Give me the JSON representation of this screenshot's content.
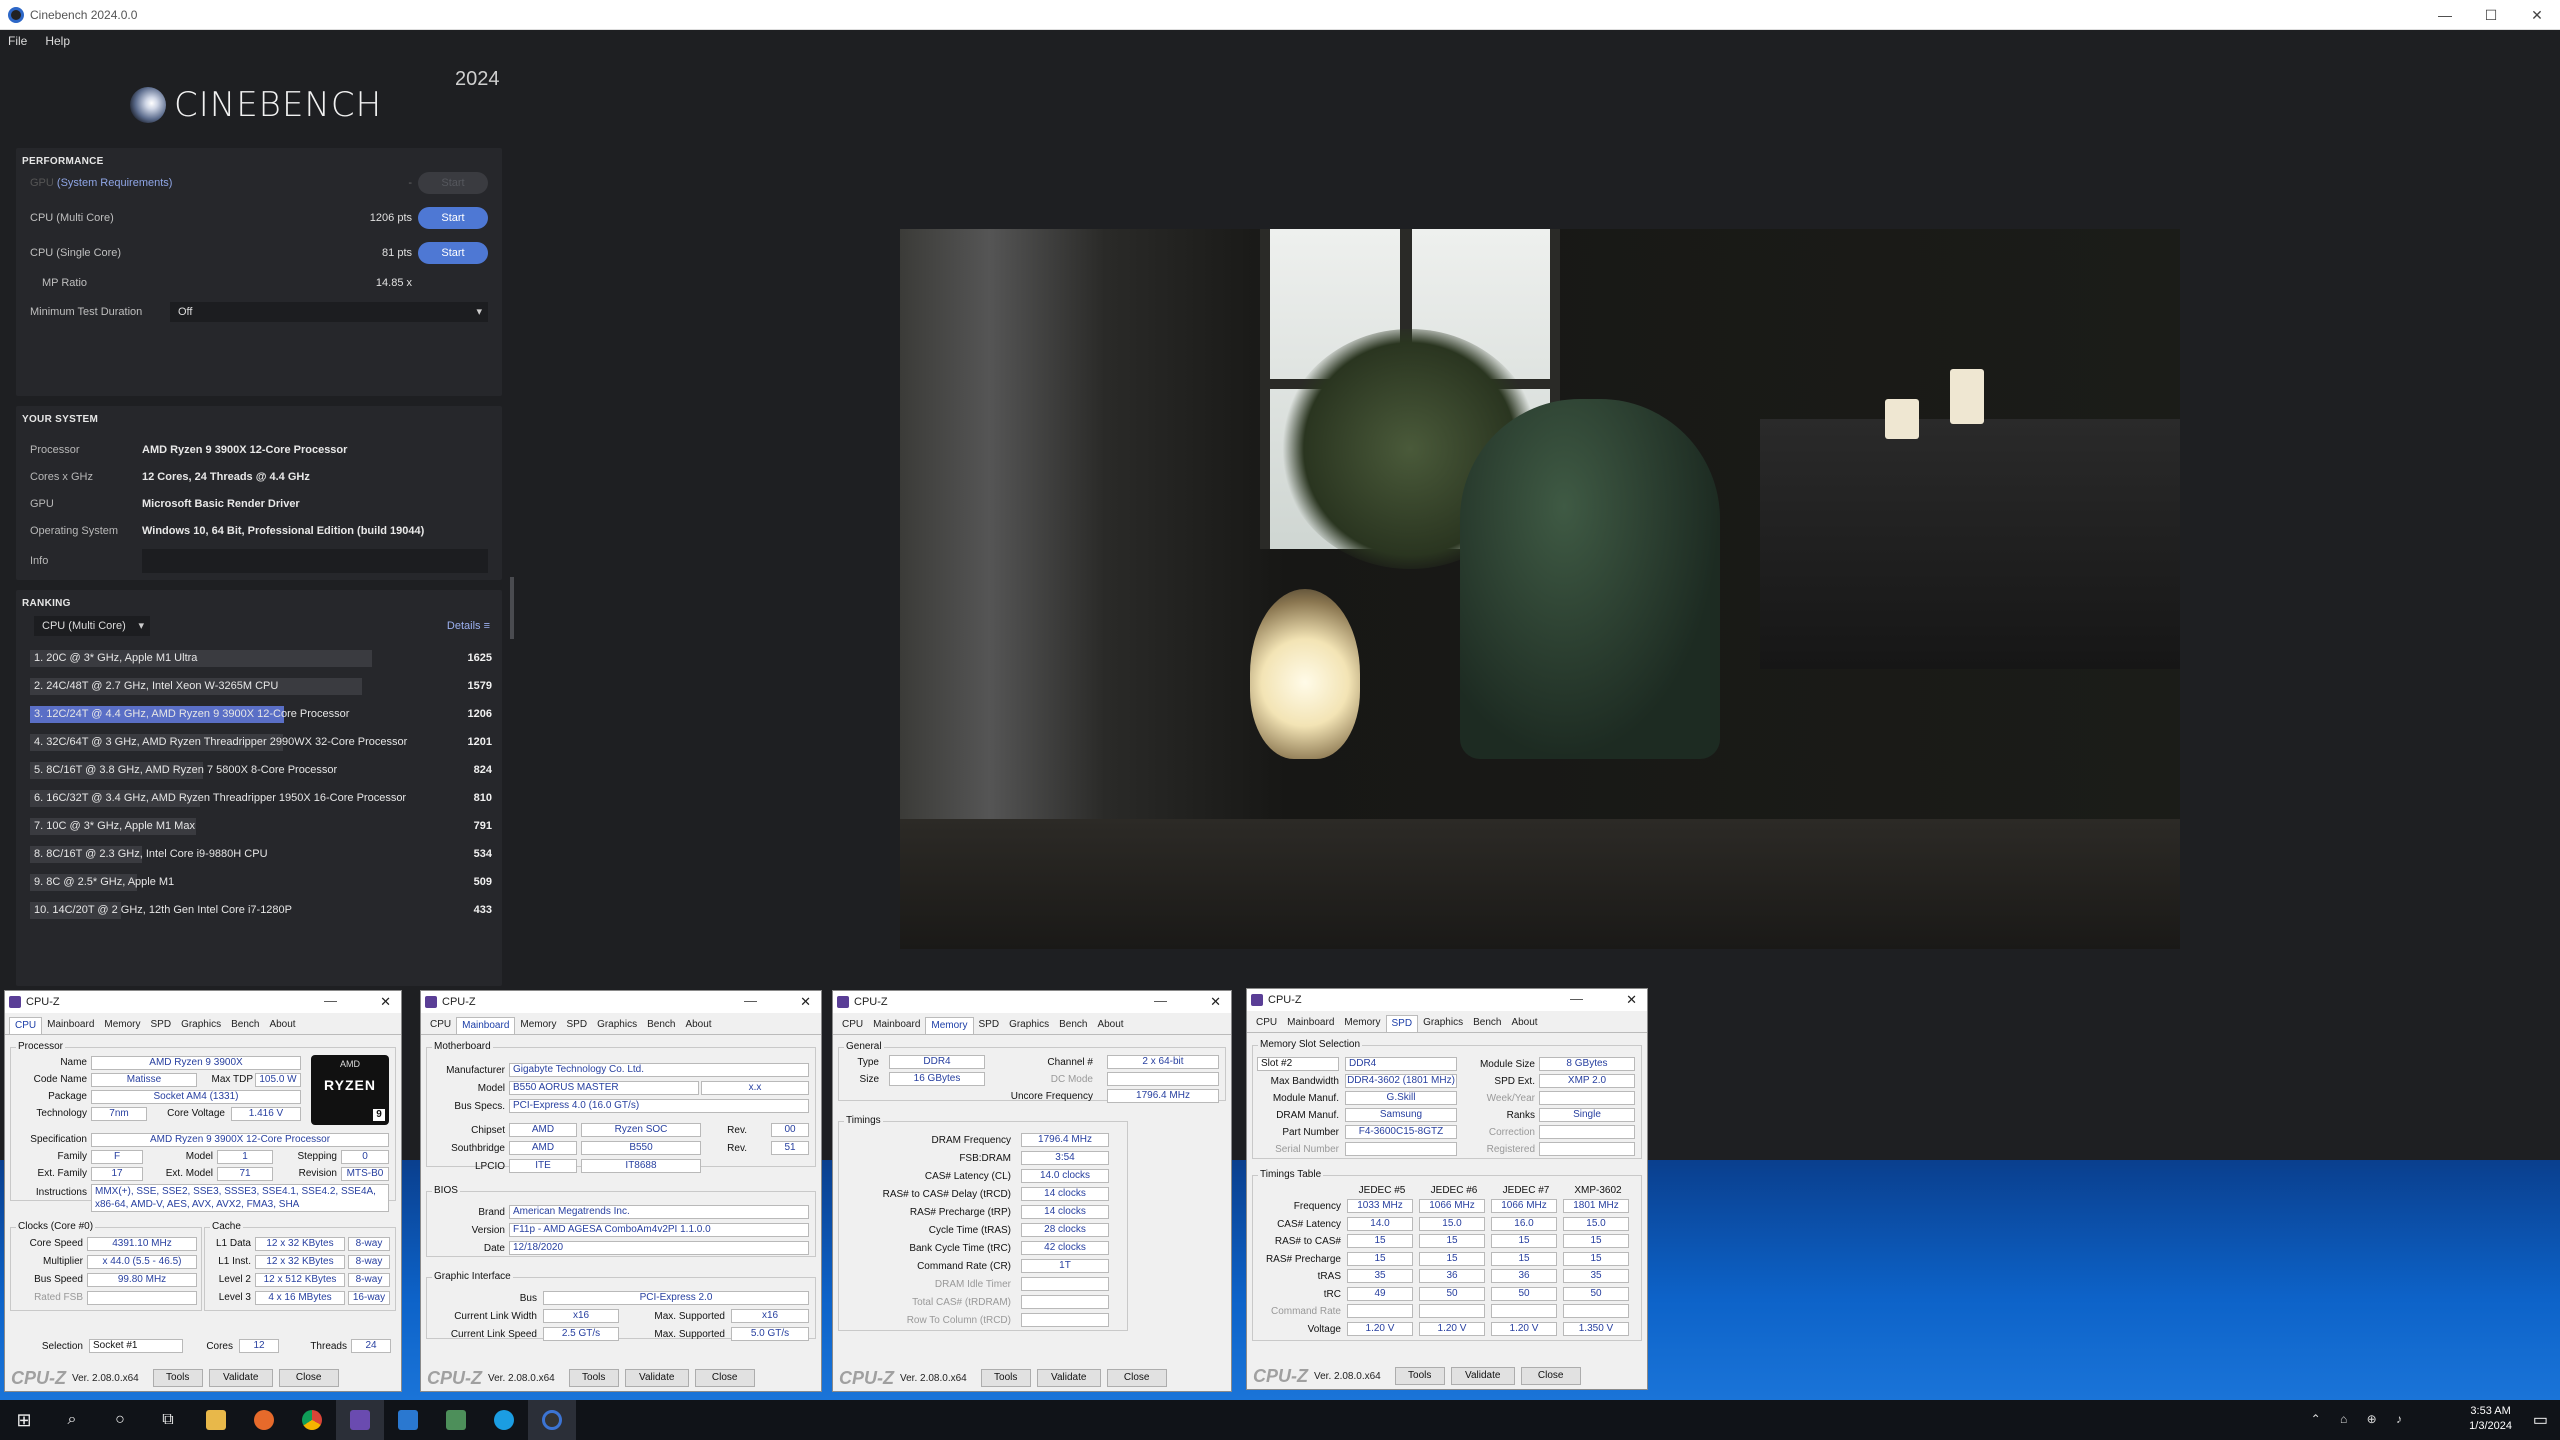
{
  "window": {
    "title": "Cinebench 2024.0.0",
    "minimize": "—",
    "maximize": "☐",
    "close": "✕"
  },
  "menu": [
    "File",
    "Help"
  ],
  "cinebench": {
    "logo": "CINEBENCH",
    "year": "2024",
    "performance": {
      "header": "PERFORMANCE",
      "gpu": {
        "label": "GPU",
        "link": "(System Requirements)",
        "value": "-",
        "button": "Start"
      },
      "multi": {
        "label": "CPU (Multi Core)",
        "value": "1206 pts",
        "button": "Start"
      },
      "single": {
        "label": "CPU (Single Core)",
        "value": "81 pts",
        "button": "Start"
      },
      "mp": {
        "label": "MP Ratio",
        "value": "14.85 x"
      },
      "duration": {
        "label": "Minimum Test Duration",
        "value": "Off"
      }
    },
    "system": {
      "header": "YOUR SYSTEM",
      "rows": [
        {
          "k": "Processor",
          "v": "AMD Ryzen 9 3900X 12-Core Processor"
        },
        {
          "k": "Cores x GHz",
          "v": "12 Cores, 24 Threads @ 4.4 GHz"
        },
        {
          "k": "GPU",
          "v": "Microsoft Basic Render Driver"
        },
        {
          "k": "Operating System",
          "v": "Windows 10, 64 Bit, Professional Edition (build 19044)"
        }
      ],
      "info_label": "Info"
    },
    "ranking": {
      "header": "RANKING",
      "filter": "CPU (Multi Core)",
      "details": "Details",
      "items": [
        {
          "label": "1. 20C @ 3* GHz, Apple M1 Ultra",
          "score": "1625",
          "frac": 1.0,
          "me": false
        },
        {
          "label": "2. 24C/48T @ 2.7 GHz, Intel Xeon W-3265M CPU",
          "score": "1579",
          "frac": 0.97,
          "me": false
        },
        {
          "label": "3. 12C/24T @ 4.4 GHz, AMD Ryzen 9 3900X 12-Core Processor",
          "score": "1206",
          "frac": 0.742,
          "me": true
        },
        {
          "label": "4. 32C/64T @ 3 GHz, AMD Ryzen Threadripper 2990WX 32-Core Processor",
          "score": "1201",
          "frac": 0.739,
          "me": false
        },
        {
          "label": "5. 8C/16T @ 3.8 GHz, AMD Ryzen 7 5800X 8-Core Processor",
          "score": "824",
          "frac": 0.507,
          "me": false
        },
        {
          "label": "6. 16C/32T @ 3.4 GHz, AMD Ryzen Threadripper 1950X 16-Core Processor",
          "score": "810",
          "frac": 0.498,
          "me": false
        },
        {
          "label": "7. 10C @ 3* GHz, Apple M1 Max",
          "score": "791",
          "frac": 0.487,
          "me": false
        },
        {
          "label": "8. 8C/16T @ 2.3 GHz, Intel Core i9-9880H CPU",
          "score": "534",
          "frac": 0.329,
          "me": false
        },
        {
          "label": "9. 8C @ 2.5* GHz, Apple M1",
          "score": "509",
          "frac": 0.313,
          "me": false
        },
        {
          "label": "10. 14C/20T @ 2 GHz, 12th Gen Intel Core i7-1280P",
          "score": "433",
          "frac": 0.266,
          "me": false
        }
      ]
    }
  },
  "cpuz_common": {
    "title": "CPU-Z",
    "brand": "CPU-Z",
    "version": "Ver. 2.08.0.x64",
    "tools": "Tools",
    "validate": "Validate",
    "close": "Close",
    "tabs": [
      "CPU",
      "Mainboard",
      "Memory",
      "SPD",
      "Graphics",
      "Bench",
      "About"
    ]
  },
  "cpuz_cpu": {
    "processor_group": "Processor",
    "name_l": "Name",
    "name": "AMD Ryzen 9 3900X",
    "codename_l": "Code Name",
    "codename": "Matisse",
    "maxtdp_l": "Max TDP",
    "maxtdp": "105.0 W",
    "package_l": "Package",
    "package": "Socket AM4 (1331)",
    "tech_l": "Technology",
    "tech": "7nm",
    "cv_l": "Core Voltage",
    "cv": "1.416 V",
    "spec_l": "Specification",
    "spec": "AMD Ryzen 9 3900X 12-Core Processor",
    "family_l": "Family",
    "family": "F",
    "model_l": "Model",
    "model": "1",
    "stepping_l": "Stepping",
    "stepping": "0",
    "extfam_l": "Ext. Family",
    "extfam": "17",
    "extmod_l": "Ext. Model",
    "extmod": "71",
    "rev_l": "Revision",
    "rev": "MTS-B0",
    "instr_l": "Instructions",
    "instr": "MMX(+), SSE, SSE2, SSE3, SSSE3, SSE4.1, SSE4.2, SSE4A,",
    "instr2": "x86-64, AMD-V, AES, AVX, AVX2, FMA3, SHA",
    "clocks_group": "Clocks (Core #0)",
    "cache_group": "Cache",
    "corespeed_l": "Core Speed",
    "corespeed": "4391.10 MHz",
    "mult_l": "Multiplier",
    "mult": "x 44.0 (5.5 - 46.5)",
    "bus_l": "Bus Speed",
    "bus": "99.80 MHz",
    "fsb_l": "Rated FSB",
    "l1d_l": "L1 Data",
    "l1d": "12 x 32 KBytes",
    "l1d_w": "8-way",
    "l1i_l": "L1 Inst.",
    "l1i": "12 x 32 KBytes",
    "l1i_w": "8-way",
    "l2_l": "Level 2",
    "l2": "12 x 512 KBytes",
    "l2_w": "8-way",
    "l3_l": "Level 3",
    "l3": "4 x 16 MBytes",
    "l3_w": "16-way",
    "sel_l": "Selection",
    "sel": "Socket #1",
    "cores_l": "Cores",
    "cores": "12",
    "threads_l": "Threads",
    "threads": "24",
    "logo_top": "AMD",
    "logo": "RYZEN",
    "logo_num": "9"
  },
  "cpuz_mb": {
    "mb_group": "Motherboard",
    "manu_l": "Manufacturer",
    "manu": "Gigabyte Technology Co. Ltd.",
    "model_l": "Model",
    "model": "B550 AORUS MASTER",
    "model2": "x.x",
    "busspec_l": "Bus Specs.",
    "busspec": "PCI-Express 4.0 (16.0 GT/s)",
    "chipset_l": "Chipset",
    "chipset": "AMD",
    "chipset2": "Ryzen SOC",
    "rev_l": "Rev.",
    "chiprev": "00",
    "south_l": "Southbridge",
    "south": "AMD",
    "south2": "B550",
    "southrev": "51",
    "lpcio_l": "LPCIO",
    "lpcio": "ITE",
    "lpcio2": "IT8688",
    "bios_group": "BIOS",
    "brand_l": "Brand",
    "brand": "American Megatrends Inc.",
    "ver_l": "Version",
    "ver": "F11p - AMD AGESA ComboAm4v2PI 1.1.0.0",
    "date_l": "Date",
    "date": "12/18/2020",
    "gi_group": "Graphic Interface",
    "gbus_l": "Bus",
    "gbus": "PCI-Express 2.0",
    "clw_l": "Current Link Width",
    "clw": "x16",
    "msup_l": "Max. Supported",
    "mlw": "x16",
    "cls_l": "Current Link Speed",
    "cls": "2.5 GT/s",
    "mls": "5.0 GT/s"
  },
  "cpuz_mem": {
    "gen_group": "General",
    "type_l": "Type",
    "type": "DDR4",
    "chan_l": "Channel #",
    "chan": "2 x 64-bit",
    "size_l": "Size",
    "size": "16 GBytes",
    "dc_l": "DC Mode",
    "unc_l": "Uncore Frequency",
    "unc": "1796.4 MHz",
    "tim_group": "Timings",
    "rows": [
      {
        "k": "DRAM Frequency",
        "v": "1796.4 MHz"
      },
      {
        "k": "FSB:DRAM",
        "v": "3:54"
      },
      {
        "k": "CAS# Latency (CL)",
        "v": "14.0 clocks"
      },
      {
        "k": "RAS# to CAS# Delay (tRCD)",
        "v": "14 clocks"
      },
      {
        "k": "RAS# Precharge (tRP)",
        "v": "14 clocks"
      },
      {
        "k": "Cycle Time (tRAS)",
        "v": "28 clocks"
      },
      {
        "k": "Bank Cycle Time (tRC)",
        "v": "42 clocks"
      },
      {
        "k": "Command Rate (CR)",
        "v": "1T"
      },
      {
        "k": "DRAM Idle Timer",
        "v": ""
      },
      {
        "k": "Total CAS# (tRDRAM)",
        "v": ""
      },
      {
        "k": "Row To Column (tRCD)",
        "v": ""
      }
    ]
  },
  "cpuz_spd": {
    "slot_group": "Memory Slot Selection",
    "slot": "Slot #2",
    "slottype": "DDR4",
    "modsize_l": "Module Size",
    "modsize": "8 GBytes",
    "maxbw_l": "Max Bandwidth",
    "maxbw": "DDR4-3602 (1801 MHz)",
    "spdext_l": "SPD Ext.",
    "spdext": "XMP 2.0",
    "modmanu_l": "Module Manuf.",
    "modmanu": "G.Skill",
    "wy_l": "Week/Year",
    "drammanu_l": "DRAM Manuf.",
    "drammanu": "Samsung",
    "ranks_l": "Ranks",
    "ranks": "Single",
    "pn_l": "Part Number",
    "pn": "F4-3600C15-8GTZ",
    "corr_l": "Correction",
    "sn_l": "Serial Number",
    "reg_l": "Registered",
    "tt_group": "Timings Table",
    "cols": [
      "JEDEC #5",
      "JEDEC #6",
      "JEDEC #7",
      "XMP-3602"
    ],
    "rows": [
      {
        "k": "Frequency",
        "v": [
          "1033 MHz",
          "1066 MHz",
          "1066 MHz",
          "1801 MHz"
        ]
      },
      {
        "k": "CAS# Latency",
        "v": [
          "14.0",
          "15.0",
          "16.0",
          "15.0"
        ]
      },
      {
        "k": "RAS# to CAS#",
        "v": [
          "15",
          "15",
          "15",
          "15"
        ]
      },
      {
        "k": "RAS# Precharge",
        "v": [
          "15",
          "15",
          "15",
          "15"
        ]
      },
      {
        "k": "tRAS",
        "v": [
          "35",
          "36",
          "36",
          "35"
        ]
      },
      {
        "k": "tRC",
        "v": [
          "49",
          "50",
          "50",
          "50"
        ]
      },
      {
        "k": "Command Rate",
        "v": [
          "",
          "",
          "",
          ""
        ]
      },
      {
        "k": "Voltage",
        "v": [
          "1.20 V",
          "1.20 V",
          "1.20 V",
          "1.350 V"
        ]
      }
    ]
  },
  "taskbar": {
    "time": "3:53 AM",
    "date": "1/3/2024"
  }
}
